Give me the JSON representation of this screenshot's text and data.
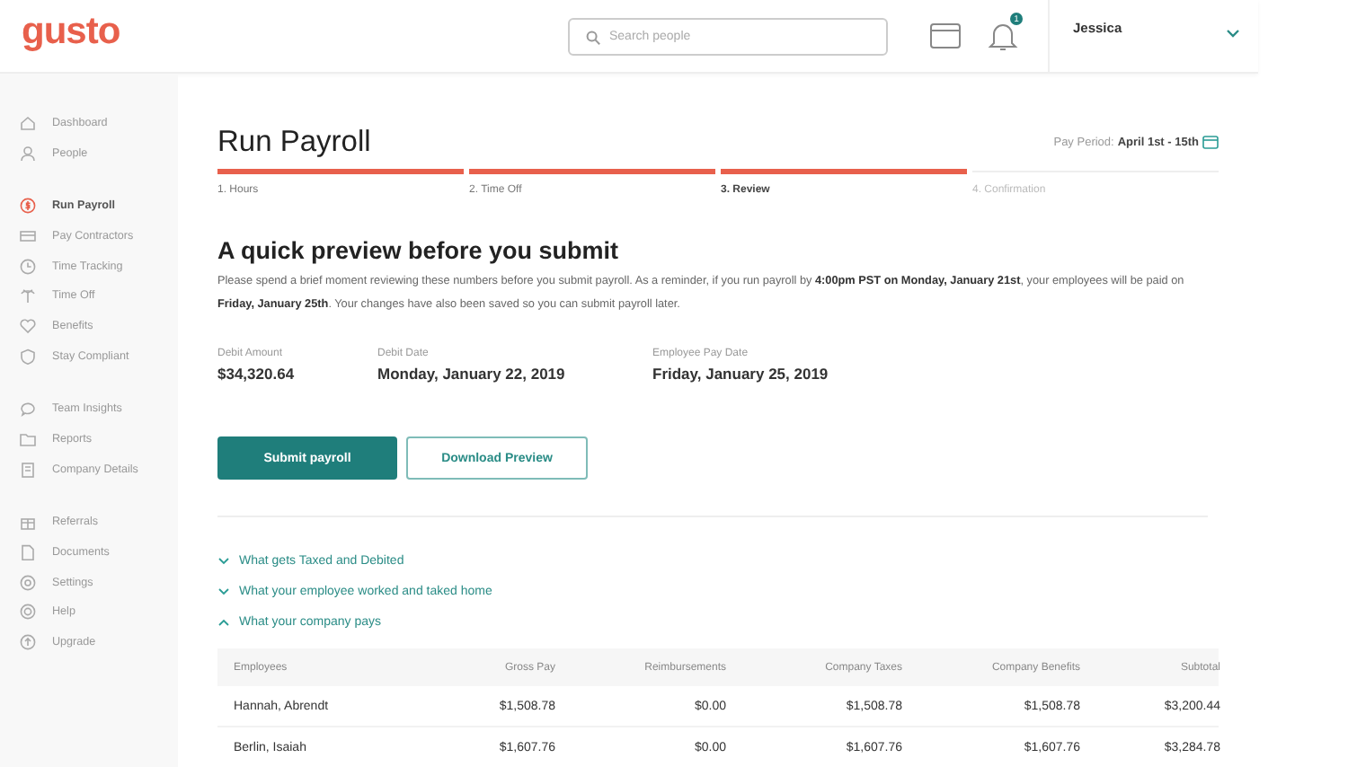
{
  "header": {
    "logo": "gusto",
    "search": {
      "placeholder": "Search people"
    },
    "notifications": {
      "badge": "1"
    },
    "user": {
      "name": "Jessica"
    }
  },
  "sidebar": {
    "sections": [
      {
        "items": [
          {
            "label": "Dashboard",
            "selected": false
          },
          {
            "label": "People",
            "selected": false
          }
        ]
      },
      {
        "items": [
          {
            "label": "Run Payroll",
            "selected": true
          },
          {
            "label": "Pay Contractors",
            "selected": false
          },
          {
            "label": "Time Tracking",
            "selected": false
          },
          {
            "label": "Time Off",
            "selected": false
          },
          {
            "label": "Benefits",
            "selected": false
          },
          {
            "label": "Stay Compliant",
            "selected": false
          }
        ]
      },
      {
        "items": [
          {
            "label": "Team Insights",
            "selected": false
          },
          {
            "label": "Reports",
            "selected": false
          },
          {
            "label": "Company Details",
            "selected": false
          }
        ]
      },
      {
        "items": [
          {
            "label": "Referrals",
            "selected": false
          },
          {
            "label": "Documents",
            "selected": false
          },
          {
            "label": "Settings",
            "selected": false
          },
          {
            "label": "Help",
            "selected": false
          },
          {
            "label": "Upgrade",
            "selected": false
          }
        ]
      }
    ]
  },
  "page": {
    "title": "Run Payroll",
    "pay_period_label": "Pay Period:",
    "pay_period": "April 1st - 15th",
    "steps": [
      {
        "label": "1. Hours",
        "complete": true,
        "selected": false
      },
      {
        "label": "2. Time Off",
        "complete": true,
        "selected": false
      },
      {
        "label": "3. Review",
        "complete": true,
        "selected": true
      },
      {
        "label": "4. Confirmation",
        "complete": false,
        "selected": false
      }
    ],
    "heading": "A quick preview before you submit",
    "message": "Please spend a brief moment reviewing these numbers before you submit payroll. As a reminder, if you run payroll by **4:00pm PST on Monday, January 21st**, your employees will be paid on **Friday, January 25th**. Your changes have also been saved so you can submit payroll later.",
    "summary": [
      {
        "label": "Debit Amount",
        "value": "$34,320.64"
      },
      {
        "label": "Debit Date",
        "value": "Monday, January 22, 2019"
      },
      {
        "label": "Employee Pay Date",
        "value": "Friday, January 25, 2019"
      }
    ],
    "buttons": [
      {
        "label": "Submit payroll",
        "kind": "primary"
      },
      {
        "label": "Download Preview",
        "kind": "secondary"
      }
    ],
    "sections": [
      {
        "label": "What gets Taxed and Debited",
        "expanded": false
      },
      {
        "label": "What your employee worked and taked home",
        "expanded": false
      },
      {
        "label": "What your company pays",
        "expanded": true
      }
    ],
    "table": {
      "columns": [
        "Employees",
        "Gross Pay",
        "Reimbursements",
        "Company Taxes",
        "Company Benefits",
        "Subtotal"
      ],
      "rows": [
        [
          "Hannah, Abrendt",
          "$1,508.78",
          "$0.00",
          "$1,508.78",
          "$1,508.78",
          "$3,200.44"
        ],
        [
          "Berlin, Isaiah",
          "$1,607.76",
          "$0.00",
          "$1,607.76",
          "$1,607.76",
          "$3,284.78"
        ]
      ]
    }
  }
}
